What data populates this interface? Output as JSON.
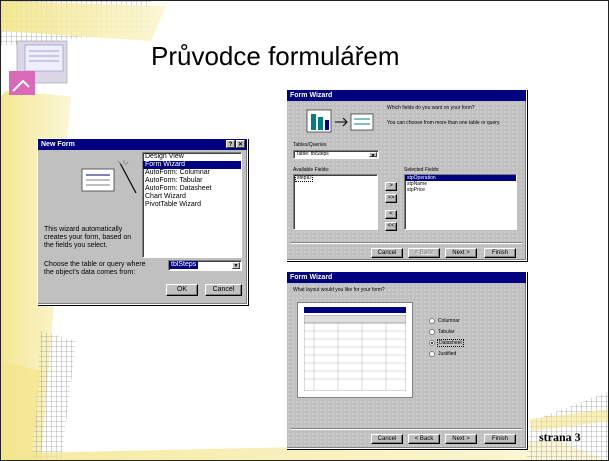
{
  "slide": {
    "title": "Průvodce formulářem",
    "page_number": "strana 3"
  },
  "new_form": {
    "window_title": "New Form",
    "help_button": "?",
    "close_button": "✕",
    "description": [
      "This wizard automatically",
      "creates your form, based on",
      "the fields you select."
    ],
    "options": [
      "Design View",
      "Form Wizard",
      "AutoForm: Columnar",
      "AutoForm: Tabular",
      "AutoForm: Datasheet",
      "Chart Wizard",
      "PivotTable Wizard"
    ],
    "selected_option": "Form Wizard",
    "choose_label": [
      "Choose the table or query where",
      "the object's data comes from:"
    ],
    "table_value": "tblSteps",
    "ok_label": "OK",
    "cancel_label": "Cancel"
  },
  "form_wizard_1": {
    "window_title": "Form Wizard",
    "question": "Which fields do you want on your form?",
    "hint": "You can choose from more than one table or query.",
    "tables_label": "Tables/Queries",
    "table_value": "Table: tblSteps",
    "available_label": "Available Fields:",
    "available_fields": [
      "stepID"
    ],
    "selected_label": "Selected Fields:",
    "selected_fields": [
      "stpOperation",
      "stpName",
      "stpPrice"
    ],
    "move_buttons": [
      ">",
      ">>",
      "<",
      "<<"
    ],
    "buttons": {
      "cancel": "Cancel",
      "back": "< Back",
      "next": "Next >",
      "finish": "Finish"
    }
  },
  "form_wizard_2": {
    "window_title": "Form Wizard",
    "question": "What layout would you like for your form?",
    "layouts": [
      "Columnar",
      "Tabular",
      "Datasheet",
      "Justified"
    ],
    "selected_layout": "Datasheet",
    "buttons": {
      "cancel": "Cancel",
      "back": "< Back",
      "next": "Next >",
      "finish": "Finish"
    }
  },
  "colors": {
    "titlebar": "#000080",
    "dialog_face": "#c0c0c0",
    "decoration_yellow": "#f7efa0",
    "decoration_pink": "#d86ab8"
  }
}
